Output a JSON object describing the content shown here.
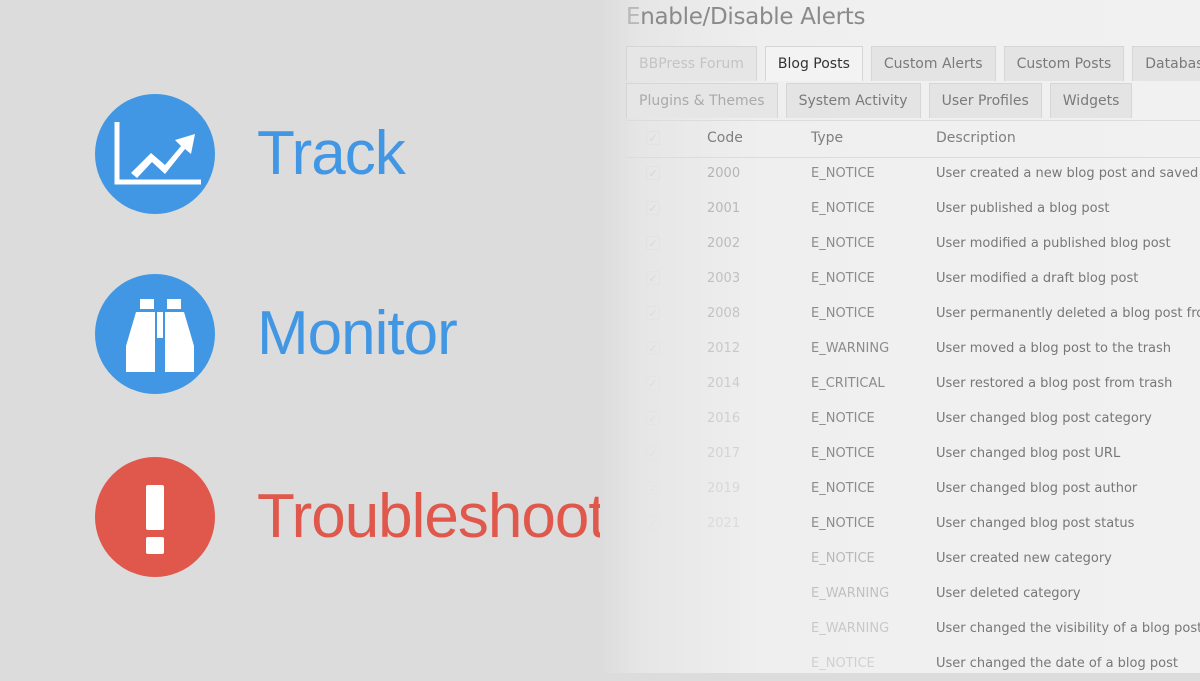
{
  "features": [
    {
      "label": "Track",
      "icon": "trend-chart-icon",
      "color": "#4197e3"
    },
    {
      "label": "Monitor",
      "icon": "binoculars-icon",
      "color": "#4197e3"
    },
    {
      "label": "Troubleshoot",
      "icon": "exclamation-icon",
      "color": "#e0574b"
    }
  ],
  "panel": {
    "title_prefix": "E",
    "title_rest": "nable/Disable Alerts",
    "tabs_row1": [
      "BBPress Forum",
      "Blog Posts",
      "Custom Alerts",
      "Custom Posts",
      "Database"
    ],
    "tabs_row2": [
      "Plugins & Themes",
      "System Activity",
      "User Profiles",
      "Widgets"
    ],
    "active_tab": "Blog Posts",
    "table": {
      "headers": {
        "code": "Code",
        "type": "Type",
        "description": "Description"
      },
      "rows": [
        {
          "code": "2000",
          "type": "E_NOTICE",
          "description": "User created a new blog post and saved it"
        },
        {
          "code": "2001",
          "type": "E_NOTICE",
          "description": "User published a blog post"
        },
        {
          "code": "2002",
          "type": "E_NOTICE",
          "description": "User modified a published blog post"
        },
        {
          "code": "2003",
          "type": "E_NOTICE",
          "description": "User modified a draft blog post"
        },
        {
          "code": "2008",
          "type": "E_NOTICE",
          "description": "User permanently deleted a blog post from"
        },
        {
          "code": "2012",
          "type": "E_WARNING",
          "description": "User moved a blog post to the trash"
        },
        {
          "code": "2014",
          "type": "E_CRITICAL",
          "description": "User restored a blog post from trash"
        },
        {
          "code": "2016",
          "type": "E_NOTICE",
          "description": "User changed blog post category"
        },
        {
          "code": "2017",
          "type": "E_NOTICE",
          "description": "User changed blog post URL"
        },
        {
          "code": "2019",
          "type": "E_NOTICE",
          "description": "User changed blog post author"
        },
        {
          "code": "2021",
          "type": "E_NOTICE",
          "description": "User changed blog post status"
        },
        {
          "code": "",
          "type": "E_NOTICE",
          "description": "User created new category"
        },
        {
          "code": "",
          "type": "E_WARNING",
          "description": "User deleted category"
        },
        {
          "code": "",
          "type": "E_WARNING",
          "description": "User changed the visibility of a blog post"
        },
        {
          "code": "",
          "type": "E_NOTICE",
          "description": "User changed the date of a blog post"
        }
      ]
    }
  }
}
